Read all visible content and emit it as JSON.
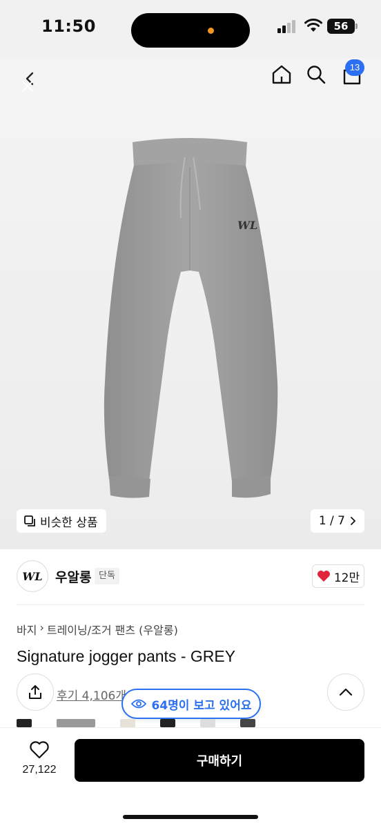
{
  "status_bar": {
    "time": "11:50",
    "battery": "56"
  },
  "nav": {
    "cart_count": "13"
  },
  "gallery": {
    "similar_label": "비슷한 상품",
    "page_indicator": "1 / 7"
  },
  "brand": {
    "name": "우알롱",
    "tag": "단독",
    "logo_text": "WL",
    "likes": "12만"
  },
  "breadcrumb": [
    "바지",
    "트레이닝/조거 팬츠 (우알롱)"
  ],
  "product": {
    "title": "Signature jogger pants - GREY"
  },
  "reviews": {
    "label": "후기 4,106개"
  },
  "viewers": {
    "label": "64명이 보고 있어요"
  },
  "bottom_bar": {
    "wish_count": "27,122",
    "buy_label": "구매하기"
  },
  "colors": {
    "accent": "#2b6ff2",
    "like_heart": "#e0243c",
    "pants": "#9c9c9c"
  }
}
